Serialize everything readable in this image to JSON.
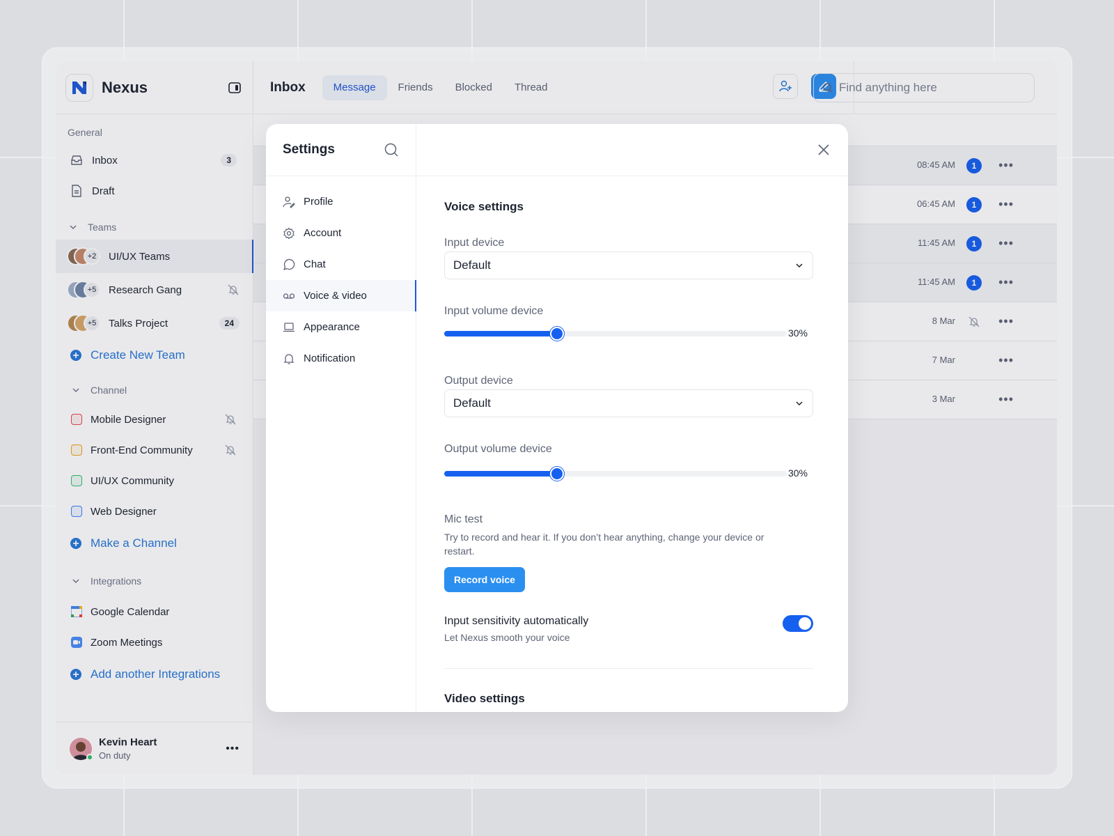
{
  "app": {
    "name": "Nexus"
  },
  "sidebar": {
    "general_label": "General",
    "inbox": {
      "label": "Inbox",
      "count": "3"
    },
    "draft": {
      "label": "Draft"
    },
    "teams_label": "Teams",
    "teams": [
      {
        "name": "UI/UX Teams",
        "more": "+2"
      },
      {
        "name": "Research Gang",
        "more": "+5"
      },
      {
        "name": "Talks Project",
        "more": "+5",
        "count": "24"
      }
    ],
    "create_team": "Create New Team",
    "channel_label": "Channel",
    "channels": [
      {
        "name": "Mobile Designer",
        "color": "#e5484d"
      },
      {
        "name": "Front-End Community",
        "color": "#f0a020"
      },
      {
        "name": "UI/UX Community",
        "color": "#2fbf71"
      },
      {
        "name": "Web Designer",
        "color": "#3b82f6"
      }
    ],
    "make_channel": "Make a Channel",
    "integrations_label": "Integrations",
    "integrations": [
      {
        "name": "Google Calendar",
        "icon": "google-calendar-icon"
      },
      {
        "name": "Zoom Meetings",
        "icon": "zoom-icon"
      }
    ],
    "add_integration": "Add another Integrations",
    "user": {
      "name": "Kevin Heart",
      "status": "On duty"
    }
  },
  "header": {
    "title": "Inbox",
    "tabs": [
      "Message",
      "Friends",
      "Blocked",
      "Thread"
    ],
    "active_tab": "Message",
    "search_placeholder": "Find anything here"
  },
  "list_rows": [
    {
      "time": "08:45 AM",
      "badge": "1"
    },
    {
      "time": "06:45 AM",
      "badge": "1"
    },
    {
      "time": "11:45 AM",
      "badge": "1"
    },
    {
      "time": "11:45 AM",
      "badge": "1"
    },
    {
      "time": "8 Mar",
      "muted": true
    },
    {
      "time": "7 Mar"
    },
    {
      "time": "3 Mar"
    }
  ],
  "settings": {
    "title": "Settings",
    "menu": [
      "Profile",
      "Account",
      "Chat",
      "Voice & video",
      "Appearance",
      "Notification"
    ],
    "active": "Voice & video",
    "voice_title": "Voice settings",
    "input_device_label": "Input device",
    "input_device_value": "Default",
    "input_volume_label": "Input volume device",
    "input_volume": 30,
    "input_volume_text": "30%",
    "output_device_label": "Output device",
    "output_device_value": "Default",
    "output_volume_label": "Output volume device",
    "output_volume": 30,
    "output_volume_text": "30%",
    "mic_test_title": "Mic test",
    "mic_test_desc": "Try to record and hear it. If you don’t hear anything, change your device or restart.",
    "record_button": "Record voice",
    "sensitivity_title": "Input sensitivity automatically",
    "sensitivity_desc": "Let Nexus smooth your voice",
    "sensitivity_on": true,
    "video_title": "Video settings"
  },
  "colors": {
    "accent": "#1660f0",
    "button_blue": "#2b8ff0",
    "link": "#2878d8"
  }
}
